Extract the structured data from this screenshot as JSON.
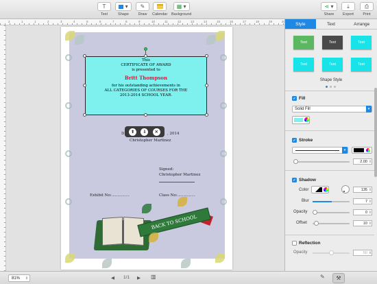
{
  "toolbar": {
    "text_label": "Text",
    "shape_label": "Shape",
    "draw_label": "Draw",
    "calendar_label": "Calendar",
    "background_label": "Background",
    "share_label": "Share",
    "export_label": "Export",
    "print_label": "Print"
  },
  "ruler": {
    "marks": [
      "2",
      "1",
      "1",
      "2",
      "3",
      "4",
      "5",
      "6",
      "7",
      "8",
      "9",
      "10",
      "11",
      "12",
      "13",
      "14",
      "15",
      "16",
      "17",
      "18",
      "19",
      "20"
    ]
  },
  "certificate": {
    "line1": "This",
    "line2": "CERTIFICATE OF AWARD",
    "line3": "is presented to",
    "recipient": "Britt Thompson",
    "line4": "for his outstanding achievements in",
    "line5": "ALL CATEGORIES OF COURSES FOR THE",
    "line6": "2013-2014 SCHOOL YEAR.",
    "date_text": "D",
    "date_suffix": ", 2014",
    "presenter": "Christopher Martinez",
    "signed_label": "Signed:",
    "signed_name": "Christopher Martinez",
    "exhibit_label": "Exhibit No:...............",
    "class_label": "Class No:...............",
    "banner_text": "BACK TO SCHOOL"
  },
  "floating_toolbar": {
    "up_label": "⬆",
    "down_label": "⇩",
    "delete_label": "✕"
  },
  "inspector": {
    "tabs": [
      {
        "label": "Style",
        "active": true
      },
      {
        "label": "Text",
        "active": false
      },
      {
        "label": "Arrange",
        "active": false
      }
    ],
    "styles": [
      {
        "label": "Text",
        "color": "#5cb860"
      },
      {
        "label": "Text",
        "color": "#4a4a4a"
      },
      {
        "label": "Text",
        "color": "#19e3e6"
      },
      {
        "label": "Text",
        "color": "#19e3e6"
      },
      {
        "label": "Text",
        "color": "#19e3e6"
      },
      {
        "label": "Text",
        "color": "#19e3e6"
      }
    ],
    "shape_style_label": "Shape Style",
    "fill": {
      "label": "Fill",
      "type": "Solid Fill",
      "color": "#7ef0ee"
    },
    "stroke": {
      "label": "Stroke",
      "width": "2.00",
      "color": "#000000"
    },
    "shadow": {
      "label": "Shadow",
      "color_label": "Color",
      "angle": "135",
      "blur_label": "Blur",
      "blur": "7",
      "opacity_label": "Opacity",
      "opacity": "0",
      "offset_label": "Offset",
      "offset": "10"
    },
    "reflection": {
      "label": "Reflection",
      "opacity_label": "Opacity",
      "opacity": "50"
    }
  },
  "bottombar": {
    "zoom": "81%",
    "page_indicator": "1/1"
  }
}
